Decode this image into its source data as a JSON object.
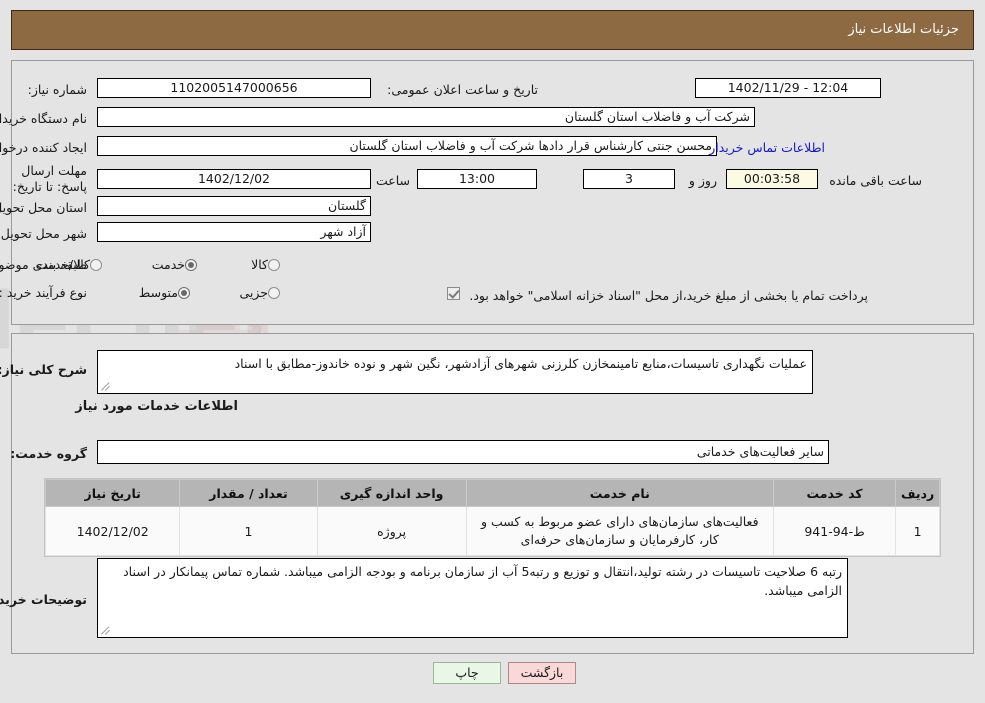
{
  "header": {
    "title": "جزئیات اطلاعات نیاز",
    "bar_color": "#8d6a41"
  },
  "form": {
    "need_number_label": "شماره نیاز:",
    "need_number_value": "1102005147000656",
    "announce_label": "تاریخ و ساعت اعلان عمومی:",
    "announce_value": "12:04 - 1402/11/29",
    "buyer_org_label": "نام دستگاه خریدار:",
    "buyer_org_value": "شرکت آب و فاضلاب استان گلستان",
    "creator_label": "ایجاد کننده درخواست:",
    "creator_value": "محسن جنتی کارشناس قرار دادها شرکت آب و فاضلاب استان گلستان",
    "contact_link": "اطلاعات تماس خریدار",
    "deadline_label": "مهلت ارسال پاسخ: تا تاریخ:",
    "deadline_date": "1402/12/02",
    "hour_label": "ساعت",
    "hour_value": "13:00",
    "days_value": "3",
    "days_label": "روز و",
    "timer_value": "00:03:58",
    "timer_label": "ساعت باقی مانده",
    "province_label": "استان محل تحویل:",
    "province_value": "گلستان",
    "city_label": "شهر محل تحویل:",
    "city_value": "آزاد شهر",
    "category_label": "طبقه بندی موضوعی:",
    "category_options": [
      {
        "label": "کالا",
        "selected": false
      },
      {
        "label": "خدمت",
        "selected": true
      },
      {
        "label": "کالا/خدمت",
        "selected": false
      }
    ],
    "process_label": "نوع فرآیند خرید :",
    "process_options": [
      {
        "label": "جزیی",
        "selected": false
      },
      {
        "label": "متوسط",
        "selected": true
      }
    ],
    "treasury_note": "پرداخت تمام یا بخشی از مبلغ خرید،از محل \"اسناد خزانه اسلامی\" خواهد بود."
  },
  "description": {
    "label": "شرح کلی نیاز:",
    "value": "عملیات نگهداری تاسیسات،منابع تامینمخازن کلرزنی شهرهای آزادشهر، نگین شهر و نوده خاندوز-مطابق با اسناد"
  },
  "services_section": {
    "title": "اطلاعات خدمات مورد نیاز",
    "group_label": "گروه خدمت:",
    "group_value": "سایر فعالیت‌های خدماتی"
  },
  "table": {
    "columns": [
      "ردیف",
      "کد خدمت",
      "نام خدمت",
      "واحد اندازه گیری",
      "تعداد / مقدار",
      "تاریخ نیاز"
    ],
    "rows": [
      {
        "row_no": "1",
        "service_code": "ط-94-941",
        "service_name": "فعالیت‌های سازمان‌های دارای عضو مربوط به کسب و کار، کارفرمایان و سازمان‌های حرفه‌ای",
        "unit": "پروژه",
        "quantity": "1",
        "need_date": "1402/12/02"
      }
    ]
  },
  "buyer_notes": {
    "label": "توضیحات خریدار:",
    "value": "رتبه 6 صلاحیت تاسیسات در رشته تولید،انتقال و توزیع و رتبه5 آب از سازمان برنامه و بودجه الزامی میباشد. شماره تماس پیمانکار در اسناد الزامی میباشد."
  },
  "footer": {
    "print_label": "چاپ",
    "back_label": "بازگشت"
  },
  "watermark": {
    "text": "AriaTender.net"
  }
}
